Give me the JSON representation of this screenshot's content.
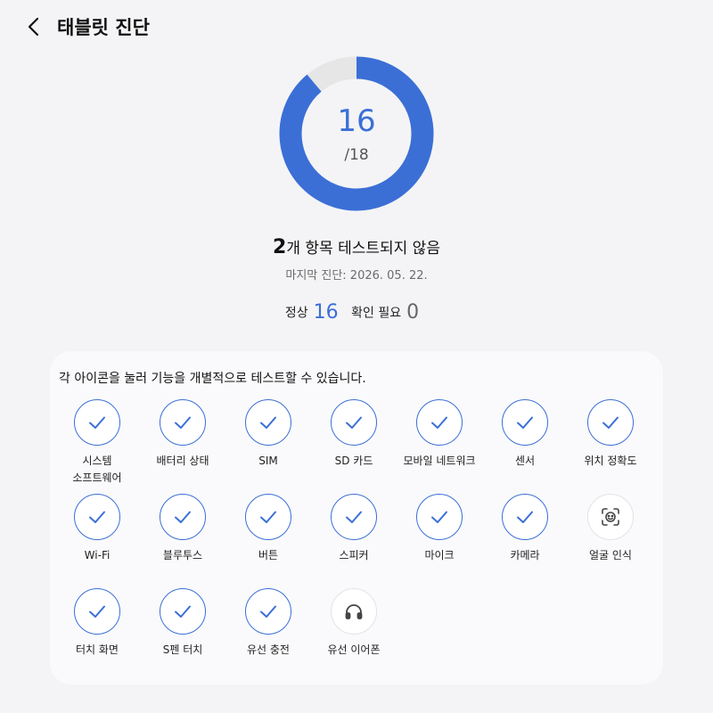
{
  "header": {
    "title": "태블릿 진단",
    "back_icon": "chevron-left-icon"
  },
  "progress": {
    "completed": "16",
    "total_label": "/18",
    "completed_value": 16,
    "total_value": 18,
    "color": "#3b6fd6",
    "remaining_color": "#e6e6e6"
  },
  "summary": {
    "count": "2",
    "text": "개 항목 테스트되지 않음"
  },
  "last_diagnosis": "마지막 진단: 2026. 05. 22.",
  "stats": {
    "normal_label": "정상",
    "normal_value": "16",
    "check_label": "확인 필요",
    "check_value": "0"
  },
  "card": {
    "description": "각 아이콘을 눌러 기능을 개별적으로 테스트할 수 있습니다.",
    "items": [
      {
        "label": "시스템",
        "label2": "소프트웨어",
        "status": "passed",
        "icon": "check-icon"
      },
      {
        "label": "배터리 상태",
        "label2": "",
        "status": "passed",
        "icon": "check-icon"
      },
      {
        "label": "SIM",
        "label2": "",
        "status": "passed",
        "icon": "check-icon"
      },
      {
        "label": "SD 카드",
        "label2": "",
        "status": "passed",
        "icon": "check-icon"
      },
      {
        "label": "모바일 네트워크",
        "label2": "",
        "status": "passed",
        "icon": "check-icon"
      },
      {
        "label": "센서",
        "label2": "",
        "status": "passed",
        "icon": "check-icon"
      },
      {
        "label": "위치 정확도",
        "label2": "",
        "status": "passed",
        "icon": "check-icon"
      },
      {
        "label": "Wi-Fi",
        "label2": "",
        "status": "passed",
        "icon": "check-icon"
      },
      {
        "label": "블루투스",
        "label2": "",
        "status": "passed",
        "icon": "check-icon"
      },
      {
        "label": "버튼",
        "label2": "",
        "status": "passed",
        "icon": "check-icon"
      },
      {
        "label": "스피커",
        "label2": "",
        "status": "passed",
        "icon": "check-icon"
      },
      {
        "label": "마이크",
        "label2": "",
        "status": "passed",
        "icon": "check-icon"
      },
      {
        "label": "카메라",
        "label2": "",
        "status": "passed",
        "icon": "check-icon"
      },
      {
        "label": "얼굴 인식",
        "label2": "",
        "status": "untested",
        "icon": "face-scan-icon"
      },
      {
        "label": "터치 화면",
        "label2": "",
        "status": "passed",
        "icon": "check-icon"
      },
      {
        "label": "S펜 터치",
        "label2": "",
        "status": "passed",
        "icon": "check-icon"
      },
      {
        "label": "유선 충전",
        "label2": "",
        "status": "passed",
        "icon": "check-icon"
      },
      {
        "label": "유선 이어폰",
        "label2": "",
        "status": "untested",
        "icon": "headphones-icon"
      }
    ]
  }
}
